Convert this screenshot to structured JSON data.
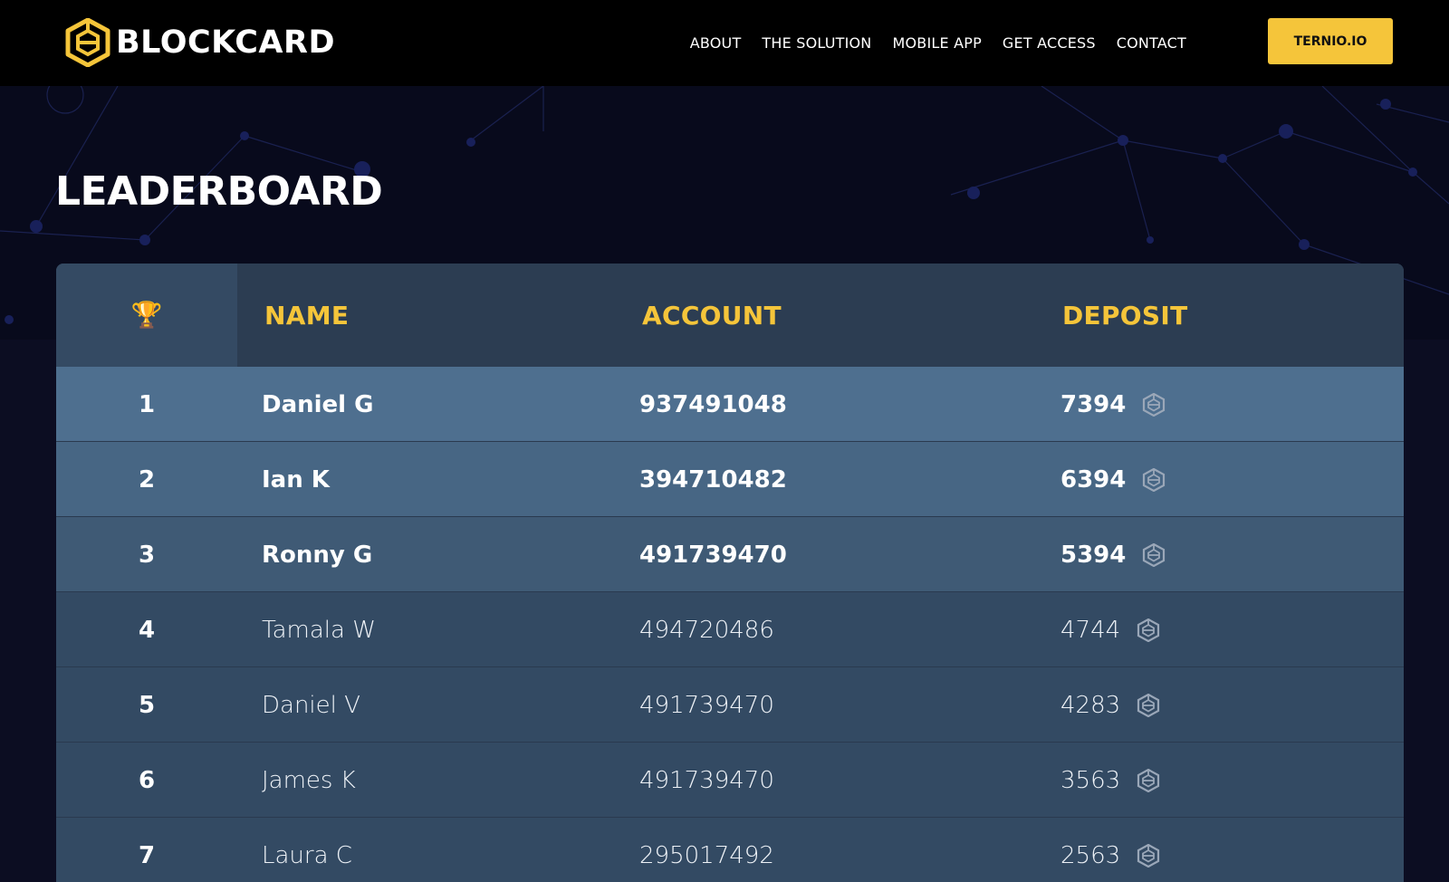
{
  "brand": {
    "name": "BLOCKCARD",
    "logo_icon": "blockcard-cube-icon"
  },
  "nav": {
    "links": [
      "ABOUT",
      "THE SOLUTION",
      "MOBILE APP",
      "GET ACCESS",
      "CONTACT"
    ],
    "cta_label": "TERNIO.IO"
  },
  "page": {
    "title": "LEADERBOARD"
  },
  "table": {
    "rank_header_icon": "trophy-icon",
    "trophy_glyph": "🏆",
    "headers": {
      "name": "NAME",
      "account": "ACCOUNT",
      "deposit": "DEPOSIT"
    },
    "deposit_icon": "blockcard-coin-icon",
    "rows": [
      {
        "rank": "1",
        "name": "Daniel G",
        "account": "937491048",
        "deposit": "7394"
      },
      {
        "rank": "2",
        "name": "Ian K",
        "account": "394710482",
        "deposit": "6394"
      },
      {
        "rank": "3",
        "name": "Ronny G",
        "account": "491739470",
        "deposit": "5394"
      },
      {
        "rank": "4",
        "name": "Tamala W",
        "account": "494720486",
        "deposit": "4744"
      },
      {
        "rank": "5",
        "name": "Daniel V",
        "account": "491739470",
        "deposit": "4283"
      },
      {
        "rank": "6",
        "name": "James K",
        "account": "491739470",
        "deposit": "3563"
      },
      {
        "rank": "7",
        "name": "Laura C",
        "account": "295017492",
        "deposit": "2563"
      }
    ]
  },
  "colors": {
    "accent": "#f5c53a",
    "nav_bg": "#000000",
    "page_bg": "#0c0d22",
    "header_bg": "#2c3d52",
    "row1_bg": "#4e6f8f",
    "row2_bg": "#476684",
    "row3_bg": "#3f5a75",
    "row_bg": "#334a63"
  }
}
